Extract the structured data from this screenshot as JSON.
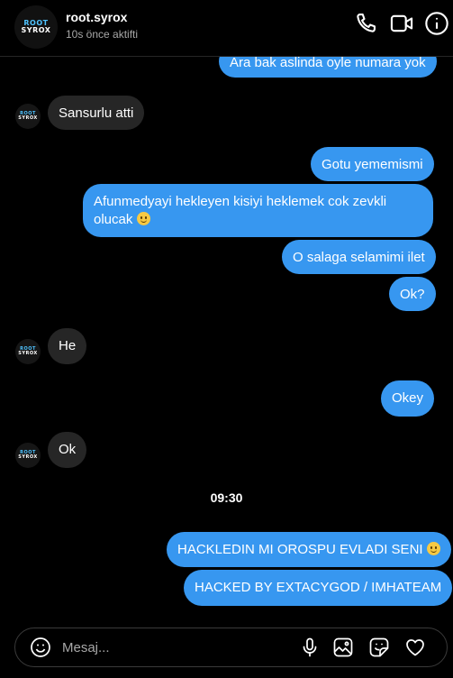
{
  "header": {
    "username": "root.syrox",
    "status": "10s önce aktifti",
    "avatar_text_top": "ROOT",
    "avatar_text_bottom": "SYROX"
  },
  "messages": [
    {
      "dir": "out",
      "text": "Ara bak aslinda oyle numara yok"
    },
    {
      "dir": "in",
      "text": "Sansurlu atti"
    },
    {
      "dir": "out",
      "text": "Gotu yememismi"
    },
    {
      "dir": "out",
      "line1": "Afunmedyayi hekleyen kisiyi heklemek cok zevkli",
      "line2": "olucak",
      "emoji": true
    },
    {
      "dir": "out",
      "text": "O salaga selamimi ilet"
    },
    {
      "dir": "out",
      "text": "Ok?"
    },
    {
      "dir": "in",
      "text": "He"
    },
    {
      "dir": "out",
      "text": "Okey"
    },
    {
      "dir": "in",
      "text": "Ok"
    },
    {
      "dir": "out",
      "text": "HACKLEDIN MI OROSPU EVLADI SENI",
      "emoji": true
    },
    {
      "dir": "out",
      "text": "HACKED BY EXTACYGOD / IMHATEAM"
    }
  ],
  "timestamp": "09:30",
  "composer": {
    "placeholder": "Mesaj..."
  },
  "colors": {
    "outgoing": "#3797f0",
    "incoming": "#262626",
    "background": "#000000"
  },
  "icons": [
    "phone-icon",
    "video-icon",
    "info-icon",
    "emoji-icon",
    "microphone-icon",
    "image-icon",
    "sticker-icon",
    "heart-icon"
  ]
}
